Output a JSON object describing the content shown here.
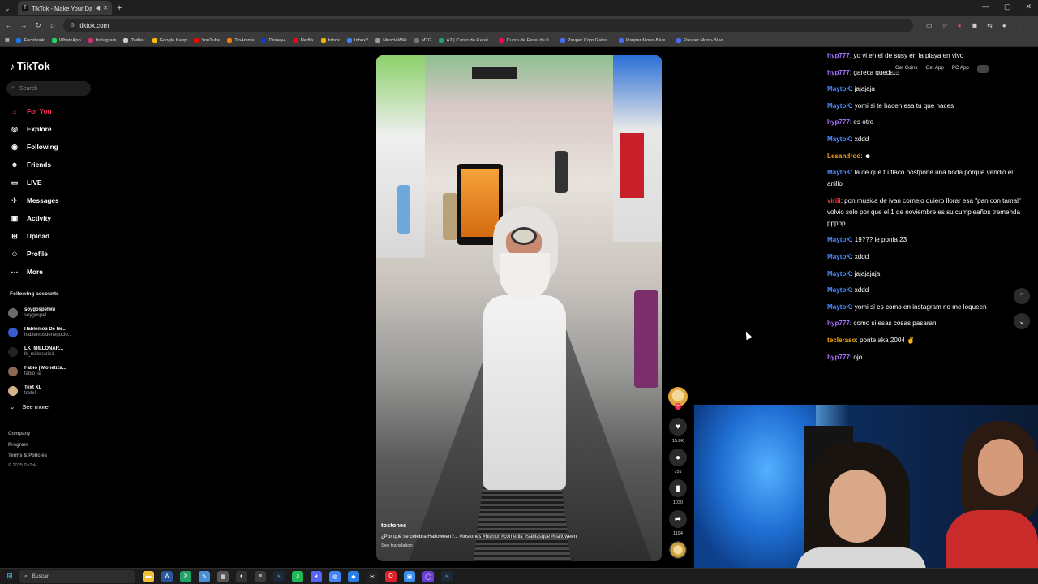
{
  "browser": {
    "tab_title": "TikTok - Make Your Day",
    "tab_favicon": "T",
    "address": "tiktok.com",
    "bookmarks": [
      {
        "label": "Facebook",
        "color": "#1877f2"
      },
      {
        "label": "WhatsApp",
        "color": "#25d366"
      },
      {
        "label": "Instagram",
        "color": "#d62976"
      },
      {
        "label": "Twitter",
        "color": "#cccccc"
      },
      {
        "label": "Google Keep",
        "color": "#fbbc04"
      },
      {
        "label": "YouTube",
        "color": "#ff0000"
      },
      {
        "label": "TioAnime",
        "color": "#f57c00"
      },
      {
        "label": "Disney+",
        "color": "#113ccf"
      },
      {
        "label": "Netflix",
        "color": "#e50914"
      },
      {
        "label": "Inbox",
        "color": "#f4b400"
      },
      {
        "label": "Inbox2",
        "color": "#4285f4"
      },
      {
        "label": "MuscleWiki",
        "color": "#999999"
      },
      {
        "label": "MTG",
        "color": "#777777"
      },
      {
        "label": "A2 | Curso de Excel...",
        "color": "#21a366"
      },
      {
        "label": "Curso de Excel de 0...",
        "color": "#ff0050"
      },
      {
        "label": "Pauper Cryo Gates...",
        "color": "#4a6cf7"
      },
      {
        "label": "Pauper Mono-Blue...",
        "color": "#4a6cf7"
      },
      {
        "label": "Pauper Mono-Blue...",
        "color": "#4a6cf7"
      }
    ]
  },
  "sidebar": {
    "logo": "TikTok",
    "search_placeholder": "Search",
    "nav": [
      {
        "label": "For You",
        "icon": "home-icon",
        "glyph": "⌂",
        "active": true
      },
      {
        "label": "Explore",
        "icon": "compass-icon",
        "glyph": "◎",
        "active": false
      },
      {
        "label": "Following",
        "icon": "following-icon",
        "glyph": "◉",
        "active": false
      },
      {
        "label": "Friends",
        "icon": "friends-icon",
        "glyph": "☻",
        "active": false
      },
      {
        "label": "LIVE",
        "icon": "live-icon",
        "glyph": "▭",
        "active": false
      },
      {
        "label": "Messages",
        "icon": "messages-icon",
        "glyph": "✈",
        "active": false
      },
      {
        "label": "Activity",
        "icon": "activity-icon",
        "glyph": "▣",
        "active": false
      },
      {
        "label": "Upload",
        "icon": "upload-icon",
        "glyph": "⊞",
        "active": false
      },
      {
        "label": "Profile",
        "icon": "profile-icon",
        "glyph": "☺",
        "active": false
      },
      {
        "label": "More",
        "icon": "more-icon",
        "glyph": "⋯",
        "active": false
      }
    ],
    "following_title": "Following accounts",
    "accounts": [
      {
        "name": "soygospelwu",
        "handle": "soygospel",
        "color": "#6b6b6b"
      },
      {
        "name": "Hablemos De Ne...",
        "handle": "hablemosdenegocio...",
        "color": "#3a5bd0"
      },
      {
        "name": "LK_MILLONAR...",
        "handle": "lk_millonario1",
        "color": "#222222"
      },
      {
        "name": "Fabio | Monetiza...",
        "handle": "fabio_ia",
        "color": "#8a6a52"
      },
      {
        "name": "Text XL",
        "handle": "textxl",
        "color": "#d2b48c"
      }
    ],
    "see_more": "See more",
    "footer": [
      "Company",
      "Program",
      "Terms & Policies"
    ],
    "copyright": "© 2025 TikTok"
  },
  "video": {
    "author": "tostones",
    "description": "¿Por qué se celebra Halloween?... #tostones #humor #comedia #sabiasque #halloween",
    "see_translation": "See translation",
    "likes": "15.8K",
    "comments": "751",
    "saves": "1030",
    "shares": "1194"
  },
  "chat": {
    "colors": {
      "hyp777": "#a970ff",
      "MaytoK": "#4f8bff",
      "Lesandrod": "#f0a020",
      "virili": "#ff3b3b",
      "tecleraso": "#ffb000"
    },
    "messages": [
      {
        "user": "hyp777",
        "text": "yo vi en el de susy en la playa en vivo"
      },
      {
        "user": "hyp777",
        "text": "gareca quedate"
      },
      {
        "user": "MaytoK",
        "text": "jajajaja"
      },
      {
        "user": "MaytoK",
        "text": "yomi si te hacen esa tu que haces"
      },
      {
        "user": "hyp777",
        "text": "es otro"
      },
      {
        "user": "MaytoK",
        "text": "xddd"
      },
      {
        "user": "Lesandrod",
        "text": ""
      },
      {
        "user": "MaytoK",
        "text": "la de que tu flaco postpone una boda porque vendio el anillo"
      },
      {
        "user": "virili",
        "text": "pon musica de ivan cornejo quiero llorar esa \"pan con tamal\" volvio solo por que el 1 de noviembre es su cumpleaños tremenda ppppp"
      },
      {
        "user": "MaytoK",
        "text": "19??? le ponia 23"
      },
      {
        "user": "MaytoK",
        "text": "xddd"
      },
      {
        "user": "MaytoK",
        "text": "jajajajaja"
      },
      {
        "user": "MaytoK",
        "text": "xddd"
      },
      {
        "user": "MaytoK",
        "text": "yomi si es como en instagram no me loqueen"
      },
      {
        "user": "hyp777",
        "text": "como si esas cosas pasaran"
      },
      {
        "user": "tecleraso",
        "text": "ponte aka 2004"
      },
      {
        "user": "hyp777",
        "text": "ojo"
      }
    ]
  },
  "get_bar": {
    "coins": "Get Coins",
    "app": "Get App",
    "pc_app": "PC App"
  },
  "taskbar": {
    "search": "Buscar",
    "apps": [
      {
        "icon": "folder-icon",
        "color": "#f2c037",
        "glyph": "▬"
      },
      {
        "icon": "word-icon",
        "color": "#2b579a",
        "glyph": "W"
      },
      {
        "icon": "excel-icon",
        "color": "#21a366",
        "glyph": "X"
      },
      {
        "icon": "notepad-icon",
        "color": "#4a90d9",
        "glyph": "✎"
      },
      {
        "icon": "calculator-icon",
        "color": "#555555",
        "glyph": "▦"
      },
      {
        "icon": "obs-icon",
        "color": "#333333",
        "glyph": "◐"
      },
      {
        "icon": "taskmanager-icon",
        "color": "#3c3c3c",
        "glyph": "≡"
      },
      {
        "icon": "steam-icon",
        "color": "#1b2838",
        "glyph": "♨"
      },
      {
        "icon": "spotify-icon",
        "color": "#1db954",
        "glyph": "♫"
      },
      {
        "icon": "discord-icon",
        "color": "#5865f2",
        "glyph": "◕"
      },
      {
        "icon": "chrome-icon",
        "color": "#4285f4",
        "glyph": "◍"
      },
      {
        "icon": "app-icon",
        "color": "#2a7de1",
        "glyph": "◆"
      },
      {
        "icon": "capcut-icon",
        "color": "#222222",
        "glyph": "✂"
      },
      {
        "icon": "opera-icon",
        "color": "#e0202a",
        "glyph": "O"
      },
      {
        "icon": "photos-icon",
        "color": "#3a8ee6",
        "glyph": "▣"
      },
      {
        "icon": "browser-icon",
        "color": "#6b3fd4",
        "glyph": "◯"
      },
      {
        "icon": "steam2-icon",
        "color": "#1b2838",
        "glyph": "♨"
      }
    ]
  }
}
